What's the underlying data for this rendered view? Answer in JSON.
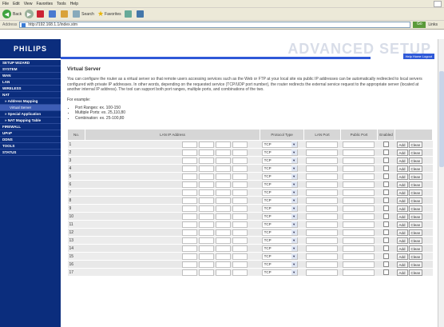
{
  "browser": {
    "menu": [
      "File",
      "Edit",
      "View",
      "Favorites",
      "Tools",
      "Help"
    ],
    "toolbar": {
      "back": "Back",
      "search": "Search",
      "favorites": "Favorites"
    },
    "address_label": "Address",
    "address": "http://192.168.1.1/index.stm",
    "go": "Go",
    "links": "Links"
  },
  "header": {
    "logo": "PHILIPS",
    "title": "ADVANCED SETUP",
    "nav": "Help  Home  Logout"
  },
  "sidebar": {
    "items": [
      {
        "label": "SETUP WIZARD",
        "level": 0
      },
      {
        "label": "SYSTEM",
        "level": 0
      },
      {
        "label": "WAN",
        "level": 0
      },
      {
        "label": "LAN",
        "level": 0
      },
      {
        "label": "WIRELESS",
        "level": 0
      },
      {
        "label": "NAT",
        "level": 0
      },
      {
        "label": "» Address Mapping",
        "level": 1
      },
      {
        "label": "Virtual Server",
        "level": 2
      },
      {
        "label": "» Special Application",
        "level": 1
      },
      {
        "label": "» NAT Mapping Table",
        "level": 1
      },
      {
        "label": "FIREWALL",
        "level": 0
      },
      {
        "label": "UPnP",
        "level": 0
      },
      {
        "label": "DDNS",
        "level": 0
      },
      {
        "label": "TOOLS",
        "level": 0
      },
      {
        "label": "STATUS",
        "level": 0
      }
    ]
  },
  "content": {
    "title": "Virtual Server",
    "description": "You can configure the router as a virtual server so that remote users accessing services such as the Web or FTP at your local site via public IP addresses can be automatically redirected to local servers configured with private IP addresses. In other words, depending on the requested service (TCP/UDP port number), the router redirects the external service request to the appropriate server (located at another internal IP address). The tool can support both port ranges, multiple ports, and combinations of the two.",
    "example_label": "For example:",
    "examples": [
      "Port Ranges: ex. 100-150",
      "Multiple Ports: ex. 25,110,80",
      "Combination: ex. 25-100,80"
    ]
  },
  "table": {
    "headers": {
      "no": "No.",
      "lan_ip": "LAN IP Address",
      "protocol": "Protocol Type",
      "lan_port": "LAN Port",
      "public_port": "Public Port",
      "enabled": "Enabled"
    },
    "protocol_default": "TCP",
    "add_label": "Add",
    "clean_label": "Clean",
    "rows": [
      "1",
      "2",
      "3",
      "4",
      "5",
      "6",
      "7",
      "8",
      "9",
      "10",
      "11",
      "12",
      "13",
      "14",
      "15",
      "16",
      "17"
    ]
  }
}
